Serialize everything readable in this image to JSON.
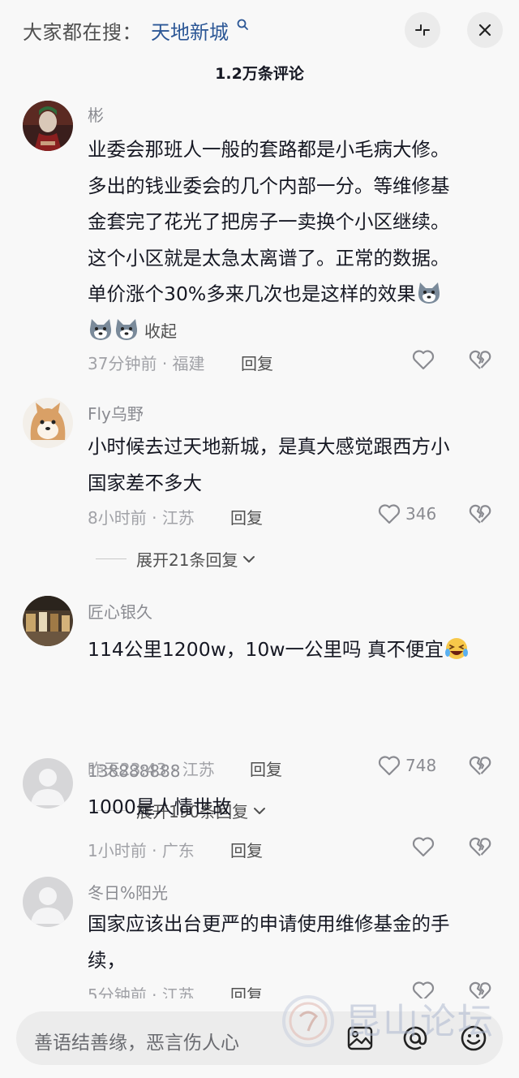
{
  "header": {
    "search_prefix": "大家都在搜：",
    "search_term": "天地新城",
    "comment_count": "1.2万条评论"
  },
  "comments": [
    {
      "username": "彬",
      "lines": [
        "业委会那班人一般的套路都是小毛病大修。",
        "多出的钱业委会的几个内部一分。等维修基",
        "金套完了花光了把房子一卖换个小区继续。",
        "这个小区就是太急太离谱了。正常的数据。",
        "单价涨个30%多来几次也是这样的效果"
      ],
      "collapse_label": "收起",
      "time": "37分钟前",
      "location": "福建",
      "reply_label": "回复",
      "likes": ""
    },
    {
      "username": "Fly乌野",
      "lines": [
        "小时候去过天地新城，是真大感觉跟西方小",
        "国家差不多大"
      ],
      "time": "8小时前",
      "location": "江苏",
      "reply_label": "回复",
      "likes": "346",
      "expand_label": "展开21条回复"
    },
    {
      "username": "匠心银久",
      "lines": [
        "114公里1200w，10w一公里吗 真不便宜"
      ],
      "time": "昨天23:43",
      "location": "江苏",
      "reply_label": "回复",
      "likes": "748",
      "expand_label": "展开190条回复"
    },
    {
      "username": "138888888",
      "lines": [
        "1000是人情世故"
      ],
      "time": "1小时前",
      "location": "广东",
      "reply_label": "回复",
      "likes": ""
    },
    {
      "username": "冬日%阳光",
      "lines": [
        "国家应该出台更严的申请使用维修基金的手",
        "续，"
      ],
      "time": "5分钟前",
      "location": "江苏",
      "reply_label": "回复",
      "likes": ""
    }
  ],
  "footer": {
    "input_placeholder": "善语结善缘，恶言伤人心",
    "watermark": "昆山论坛"
  },
  "icons": {
    "search": "search-icon",
    "collapse": "collapse-icon",
    "close": "close-icon",
    "like": "heart-icon",
    "dislike": "broken-heart-icon",
    "image": "image-icon",
    "mention": "at-icon",
    "emoji": "emoji-icon"
  },
  "colors": {
    "accent_link": "#2c5796",
    "background": "#f8f8f8",
    "muted_text": "#a1a2a7"
  }
}
